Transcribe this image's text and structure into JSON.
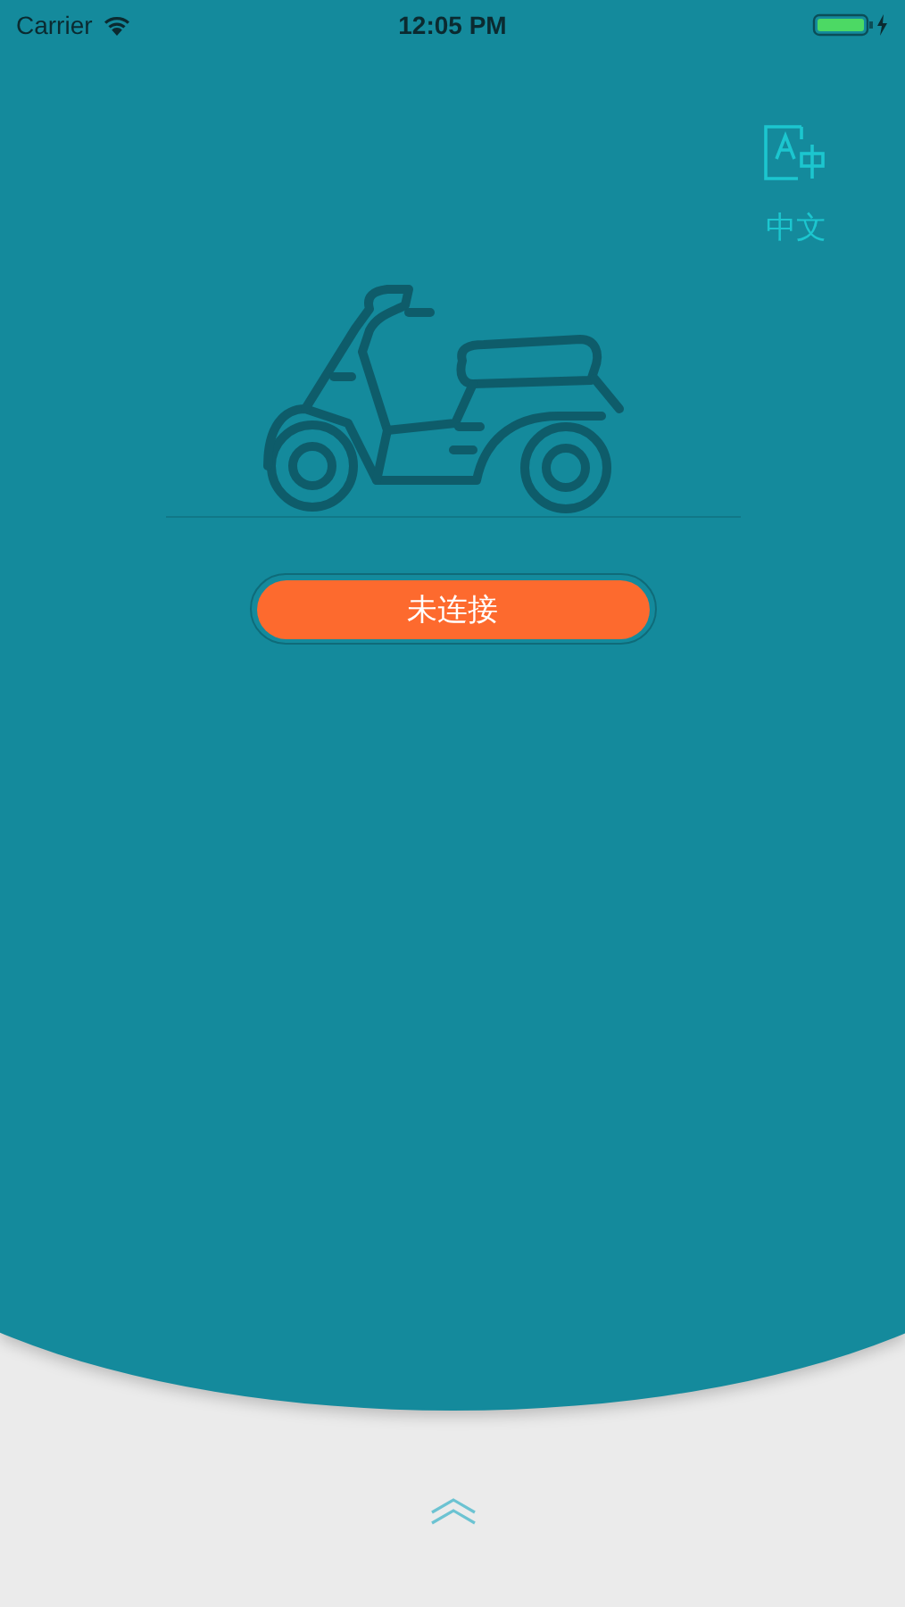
{
  "status_bar": {
    "carrier": "Carrier",
    "time": "12:05 PM"
  },
  "language": {
    "label": "中文"
  },
  "connection": {
    "label": "未连接"
  }
}
